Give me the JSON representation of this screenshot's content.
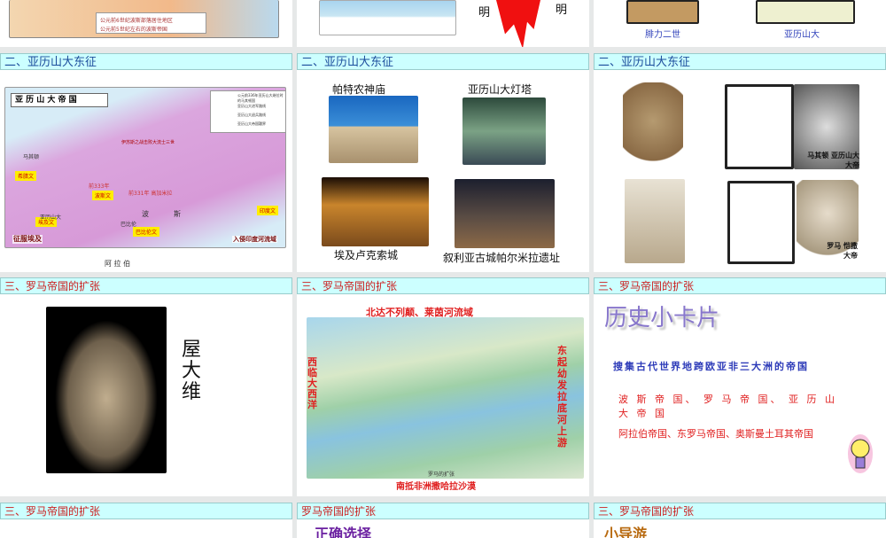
{
  "row1": {
    "slide1": {
      "legend": [
        "公元前6世纪波斯部落居住地区",
        "公元前5世纪左右的波斯帝国"
      ]
    },
    "slide2": {
      "left_char": "明",
      "right_char": "明"
    },
    "slide3": {
      "captions": [
        "腓力二世",
        "亚历山大"
      ]
    }
  },
  "row2": {
    "header": "二、亚历山大东征",
    "slide1": {
      "map_title": "亚 历 山 大 帝 国",
      "legend": [
        "公元前336年亚历山大继位时的马其顿国",
        "亚历山大进军路线",
        "亚历山大退兵路线",
        "亚历山大帝国疆界"
      ],
      "tags": [
        "希腊文",
        "埃及文",
        "波斯文",
        "巴比伦文",
        "印度文"
      ],
      "places": [
        "马其顿",
        "前333年",
        "前331年 高加米拉",
        "亚历山大",
        "巴比伦",
        "波",
        "斯",
        "阿 拉 伯",
        "征服埃及",
        "入侵印度河流域",
        "伊苏斯之战击败大流士三世"
      ]
    },
    "slide2": {
      "captions": [
        "帕特农神庙",
        "亚历山大灯塔",
        "埃及卢克索城",
        "叙利亚古城帕尔米拉遗址"
      ]
    },
    "slide3": {
      "card_labels": [
        "马其顿 亚历山大大帝",
        "罗马 恺撒大帝"
      ]
    }
  },
  "row3": {
    "header": "三、罗马帝国的扩张",
    "slide1": {
      "name": "屋大维"
    },
    "slide2": {
      "north": "北达不列颠、莱茵河流域",
      "west": "西临大西洋",
      "east": "东起幼发拉底河上游",
      "south": "南抵非洲撒哈拉沙漠",
      "map_caption": "罗马的扩张"
    },
    "slide3": {
      "title": "历史小卡片",
      "question": "搜集古代世界地跨欧亚非三大洲的帝国",
      "answer1": "波 斯 帝 国、 罗 马 帝 国、 亚 历 山 大 帝 国",
      "answer2": "阿拉伯帝国、东罗马帝国、奥斯曼土耳其帝国"
    }
  },
  "row4": {
    "headers": [
      "三、罗马帝国的扩张",
      "罗马帝国的扩张",
      "三、罗马帝国的扩张"
    ],
    "snippets": [
      "正确选择",
      "小导游"
    ]
  }
}
